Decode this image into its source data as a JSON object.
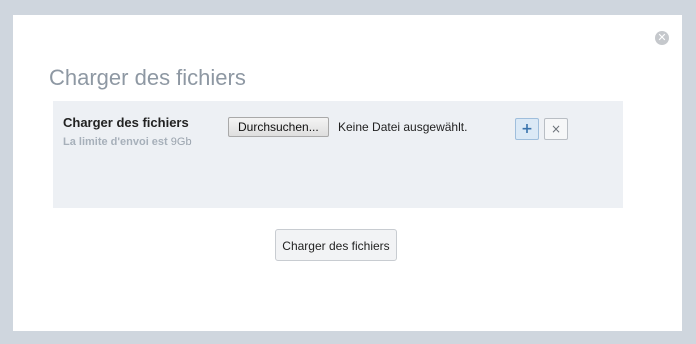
{
  "dialog": {
    "title": "Charger des fichiers",
    "close_icon": "close-icon",
    "close_symbol": "✕"
  },
  "upload_row": {
    "label": "Charger des fichiers",
    "hint_text": "La limite d'envoi est",
    "hint_value": "9Gb",
    "browse_label": "Durchsuchen...",
    "file_status": "Keine Datei ausgewählt.",
    "add_icon": "plus-icon",
    "add_symbol": "+",
    "remove_icon": "close-icon",
    "remove_symbol": "×"
  },
  "actions": {
    "submit_label": "Charger des fichiers"
  },
  "colors": {
    "backdrop": "#cfd6de",
    "panel": "#edf0f4",
    "title": "#8e98a3",
    "accent": "#3b74ad"
  }
}
